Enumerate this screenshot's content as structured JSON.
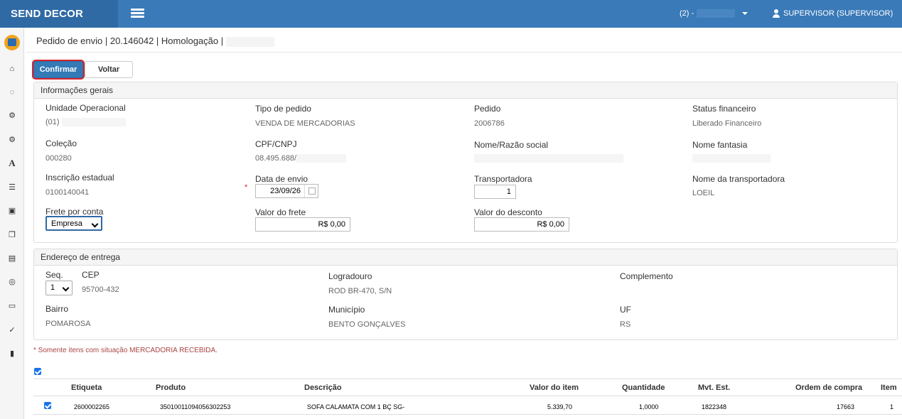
{
  "topbar": {
    "brand": "SEND DECOR",
    "tenant_prefix": "(2) -",
    "user": "SUPERVISOR (SUPERVISOR)"
  },
  "sidebar": {
    "icons": [
      "home-icon",
      "spinner-icon",
      "gears-icon",
      "gear-icon",
      "font-icon",
      "list-icon",
      "car-icon",
      "copy-icon",
      "file-icon",
      "globe-icon",
      "laptop-icon",
      "wrench-icon",
      "document-icon"
    ]
  },
  "breadcrumb": "Pedido de envio | 20.146042 | Homologação |",
  "actions": {
    "confirm": "Confirmar",
    "back": "Voltar"
  },
  "general": {
    "title": "Informações gerais",
    "unidade_label": "Unidade Operacional",
    "unidade_value": "(01)",
    "tipo_label": "Tipo de pedido",
    "tipo_value": "VENDA DE MERCADORIAS",
    "pedido_label": "Pedido",
    "pedido_value": "2006786",
    "status_label": "Status financeiro",
    "status_value": "Liberado Financeiro",
    "colecao_label": "Coleção",
    "colecao_value": "000280",
    "cpf_label": "CPF/CNPJ",
    "cpf_value": "08.495.688/",
    "nome_label": "Nome/Razão social",
    "fantasia_label": "Nome fantasia",
    "ie_label": "Inscrição estadual",
    "ie_value": "0100140041",
    "data_label": "Data de envio",
    "data_value": "23/09/26",
    "required_mark": "*",
    "transp_label": "Transportadora",
    "transp_value": "1",
    "nome_transp_label": "Nome da transportadora",
    "nome_transp_value": "LOEIL",
    "frete_conta_label": "Frete por conta",
    "frete_conta_value": "Empresa",
    "valor_frete_label": "Valor do frete",
    "valor_frete_value": "R$ 0,00",
    "valor_desc_label": "Valor do desconto",
    "valor_desc_value": "R$ 0,00"
  },
  "address": {
    "title": "Endereço de entrega",
    "seq_label": "Seq.",
    "seq_value": "1",
    "cep_label": "CEP",
    "cep_value": "95700-432",
    "logradouro_label": "Logradouro",
    "logradouro_value": "ROD BR-470, S/N",
    "complemento_label": "Complemento",
    "bairro_label": "Bairro",
    "bairro_value": "POMAROSA",
    "municipio_label": "Município",
    "municipio_value": "BENTO GONÇALVES",
    "uf_label": "UF",
    "uf_value": "RS"
  },
  "note": "* Somente itens com situação MERCADORIA RECEBIDA.",
  "table": {
    "headers": [
      "Etiqueta",
      "Produto",
      "Descrição",
      "Valor do item",
      "Quantidade",
      "Mvt. Est.",
      "Ordem de compra",
      "Item"
    ],
    "rows": [
      [
        "2600002265",
        "35010011094056302253",
        "SOFA CALAMATA COM 1 BÇ SG-",
        "5.339,70",
        "1,0000",
        "1822348",
        "17663",
        "1"
      ]
    ]
  }
}
